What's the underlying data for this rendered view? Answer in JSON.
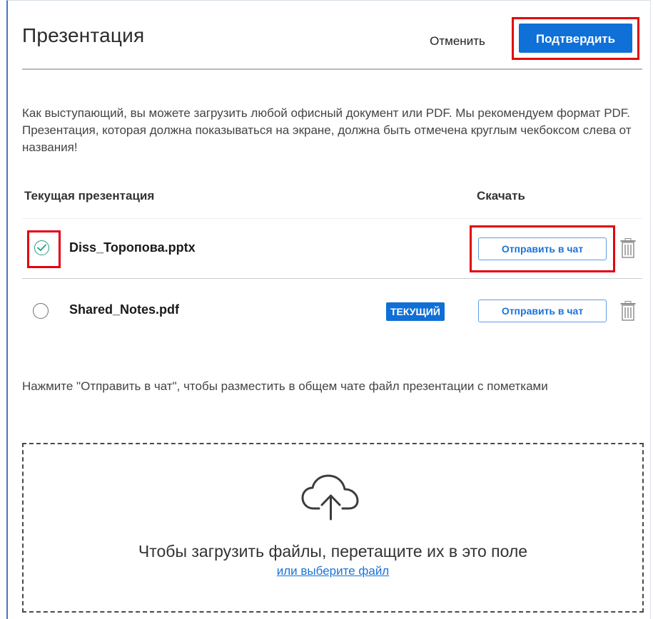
{
  "dialog": {
    "title": "Презентация",
    "cancel_label": "Отменить",
    "confirm_label": "Подтвердить",
    "intro_text": "Как выступающий, вы можете загрузить любой офисный документ или PDF. Мы рекомендуем формат PDF. Презентация, которая должна показываться на экране, должна быть отмечена круглым чекбоксом слева от названия!"
  },
  "table": {
    "col_current": "Текущая презентация",
    "col_download": "Скачать",
    "rows": [
      {
        "filename": "Diss_Торопова.pptx",
        "selected": true,
        "badge": "",
        "send_label": "Отправить в чат"
      },
      {
        "filename": "Shared_Notes.pdf",
        "selected": false,
        "badge": "ТЕКУЩИЙ",
        "send_label": "Отправить в чат"
      }
    ]
  },
  "hint_text": "Нажмите \"Отправить в чат\", чтобы разместить в общем чате файл презентации с пометками",
  "dropzone": {
    "text": "Чтобы загрузить файлы, перетащите их в это поле",
    "link_label": "или выберите файл",
    "icon": "cloud-upload-icon"
  },
  "colors": {
    "primary": "#0f70d7",
    "link": "#1a73d9",
    "highlight": "#e3000f",
    "check": "#239e7f"
  }
}
